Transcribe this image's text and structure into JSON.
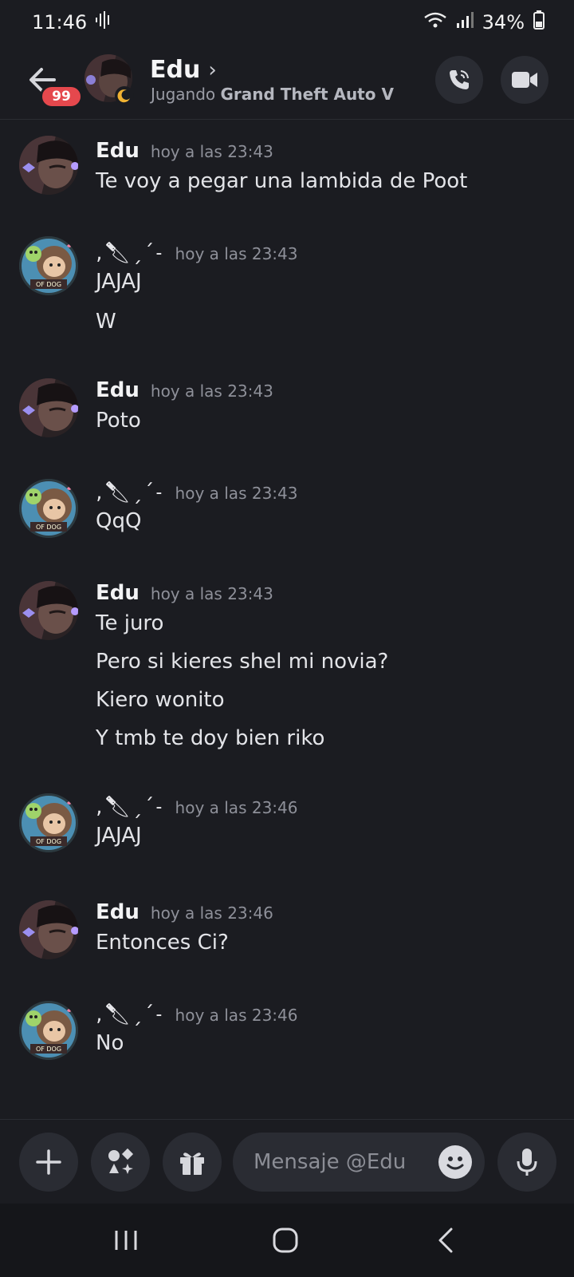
{
  "status_bar": {
    "time": "11:46",
    "battery": "34%"
  },
  "header": {
    "back_badge": "99",
    "name": "Edu",
    "chevron": "›",
    "status_prefix": "Jugando",
    "status_game": "Grand Theft Auto V"
  },
  "messages": [
    {
      "author": "Edu",
      "time": "hoy a las 23:43",
      "lines": [
        "Te voy a pegar una lambida de Poot"
      ]
    },
    {
      "author": "‚🔪︎ˏˊ˗",
      "time": "hoy a las 23:43",
      "lines": [
        "JAJAJ",
        "W"
      ]
    },
    {
      "author": "Edu",
      "time": "hoy a las 23:43",
      "lines": [
        "Poto"
      ]
    },
    {
      "author": "‚🔪︎ˏˊ˗",
      "time": "hoy a las 23:43",
      "lines": [
        "QqQ"
      ]
    },
    {
      "author": "Edu",
      "time": "hoy a las 23:43",
      "lines": [
        "Te juro",
        "Pero si kieres shel mi novia?",
        "Kiero wonito",
        "Y tmb te doy bien riko"
      ]
    },
    {
      "author": "‚🔪︎ˏˊ˗",
      "time": "hoy a las 23:46",
      "lines": [
        "JAJAJ"
      ]
    },
    {
      "author": "Edu",
      "time": "hoy a las 23:46",
      "lines": [
        "Entonces Ci?"
      ]
    },
    {
      "author": "‚🔪︎ˏˊ˗",
      "time": "hoy a las 23:46",
      "lines": [
        "No"
      ]
    }
  ],
  "composer": {
    "placeholder": "Mensaje @Edu"
  },
  "avatars": {
    "dog_text": "OF DOG"
  },
  "colors": {
    "background": "#1b1c21",
    "badge": "#e5484d",
    "button": "#2a2c33"
  }
}
